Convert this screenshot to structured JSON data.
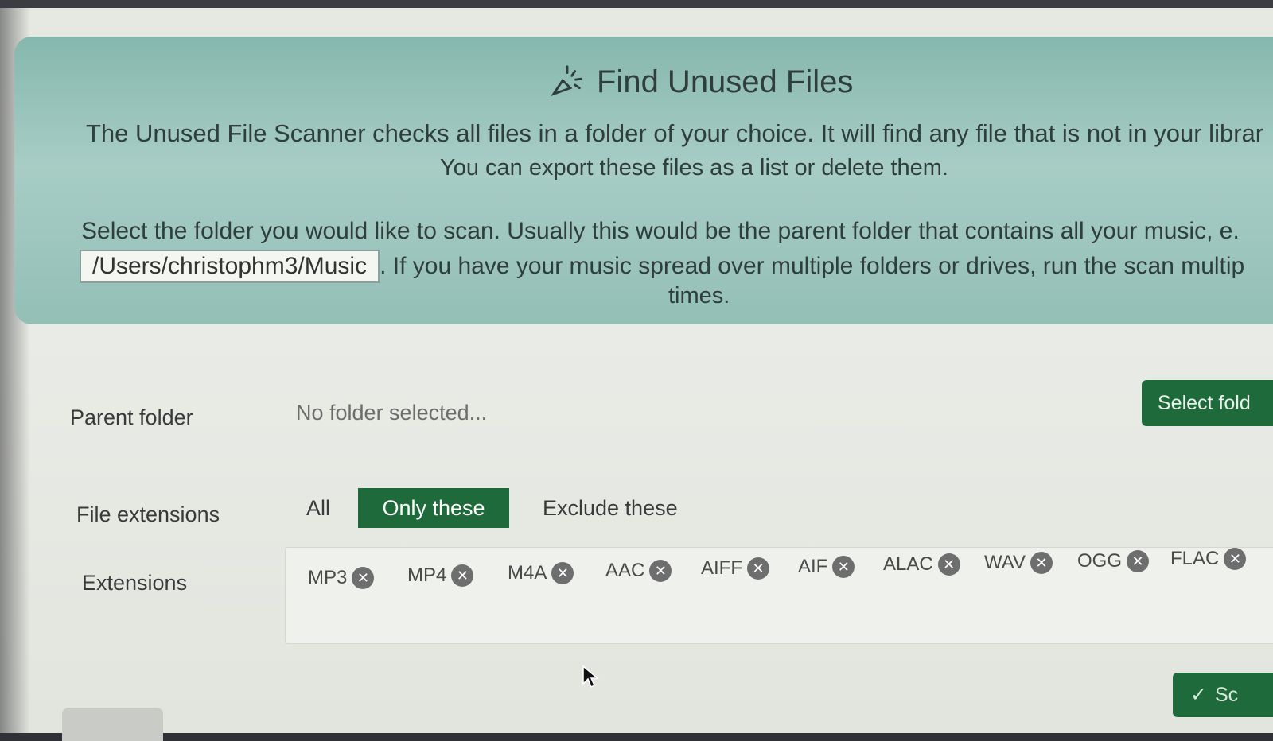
{
  "banner": {
    "title": "Find Unused Files",
    "title_icon": "sparkle-magic-icon",
    "description_line1": "The Unused File Scanner checks all files in a folder of your choice. It will find any file that is not in your librar",
    "description_line2": "You can export these files as a list or delete them.",
    "select_line1": "Select the folder you would like to scan. Usually this would be the parent folder that contains all your music, e.",
    "example_path": "/Users/christophm3/Music",
    "select_line2_rest": ". If you have your music spread over multiple folders or drives, run the scan multip",
    "select_line3": "times."
  },
  "form": {
    "parent_folder_label": "Parent folder",
    "parent_folder_value": "No folder selected...",
    "select_folder_button": "Select fold",
    "file_extensions_label": "File extensions",
    "mode_options": [
      "All",
      "Only these",
      "Exclude these"
    ],
    "mode_selected": "Only these",
    "extensions_label": "Extensions",
    "extensions": [
      "MP3",
      "MP4",
      "M4A",
      "AAC",
      "AIFF",
      "AIF",
      "ALAC",
      "WAV",
      "OGG",
      "FLAC"
    ],
    "scan_button": "Sc"
  },
  "colors": {
    "accent": "#1f6a3a",
    "banner": "#9cc6bd"
  }
}
